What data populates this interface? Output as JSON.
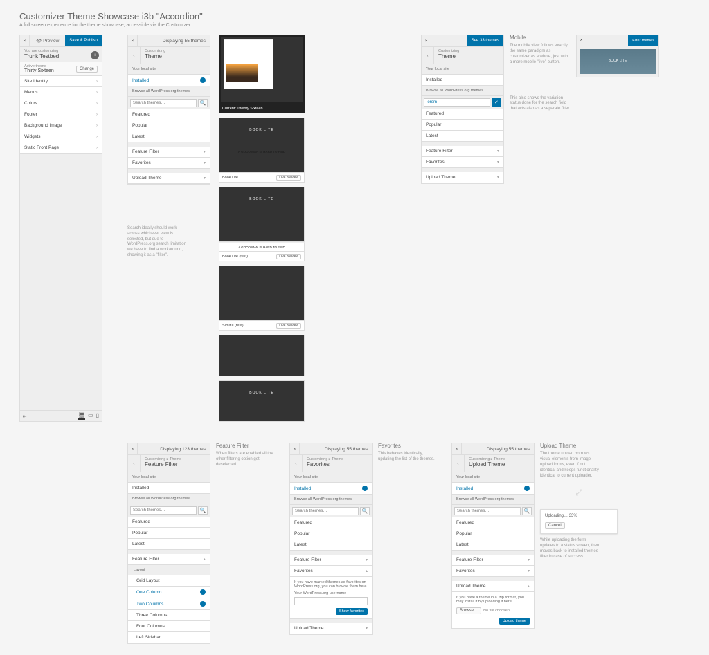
{
  "header": {
    "title": "Customizer Theme Showcase i3b \"Accordion\"",
    "subtitle": "A full screen experience for the theme showcase, accessible via the Customizer."
  },
  "p1": {
    "close_icon": "×",
    "preview_icon": "👁",
    "preview": "Preview",
    "save": "Save & Publish",
    "eyebrow": "You are customizing",
    "site": "Trunk Testbed",
    "info": "i",
    "active_label": "Active theme",
    "active_theme": "Thirty Sixteen",
    "change": "Change",
    "sections": [
      "Site Identity",
      "Menus",
      "Colors",
      "Footer",
      "Background Image",
      "Widgets",
      "Static Front Page"
    ],
    "collapse_icon": "⇤",
    "dev_desktop": "🖥",
    "dev_tablet": "▭",
    "dev_mobile": "▯"
  },
  "note_search": "Search ideally should work across whichever view is selected, but due to WordPress.org search limitation we have to find a workaround, showing it as a \"filter\".",
  "p2": {
    "count": "Displaying 55 themes",
    "back": "‹",
    "crumb": "Customizing",
    "title": "Theme",
    "local": "Your local site",
    "installed": "Installed",
    "browse": "Browse all WordPress.org themes",
    "search_ph": "Search themes…",
    "search_icon": "🔍",
    "cats": [
      "Featured",
      "Popular",
      "Latest"
    ],
    "filters": [
      "Feature Filter",
      "Favorites",
      "Upload Theme"
    ],
    "chev": "▾"
  },
  "themes": {
    "current_label": "Current: Twenty Sixteen",
    "live": "Live preview",
    "t_book": "BOOK LITE",
    "t_hard": "A GOOD MAN IS HARD TO FIND",
    "n_book": "Book Lite",
    "n_book_test": "Book Lite (test)",
    "n_sim": "Simiful (test)"
  },
  "p3": {
    "see": "See 33 themes",
    "crumb": "Customizing",
    "title": "Theme",
    "local": "Your local site",
    "installed": "Installed",
    "browse": "Browse all WordPress.org themes",
    "search_val": "lorem",
    "cats": [
      "Featured",
      "Popular",
      "Latest"
    ],
    "filters": [
      "Feature Filter",
      "Favorites",
      "Upload Theme"
    ]
  },
  "mobile": {
    "h": "Mobile",
    "p1": "The mobile view follows exactly the same paradigm as customizer as a whole, just with a more mobile \"live\" button.",
    "p2": "This also shows the variation status done for the search field that acts also as a separate filter.",
    "filter": "Filter themes"
  },
  "p4": {
    "count": "Displaying 123 themes",
    "crumb": "Customizing ▸ Theme",
    "title": "Feature Filter",
    "local": "Your local site",
    "installed": "Installed",
    "browse": "Browse all WordPress.org themes",
    "search_ph": "Search themes…",
    "cats": [
      "Featured",
      "Popular",
      "Latest"
    ],
    "ff": "Feature Filter",
    "layout": "Layout",
    "opts": [
      "Grid Layout",
      "One Column",
      "Two Columns",
      "Three Columns",
      "Four Columns",
      "Left Sidebar"
    ],
    "active": [
      1,
      2
    ]
  },
  "ff_note": {
    "h": "Feature Filter",
    "p": "When filters are enabled all the other filtering option get deselected."
  },
  "p5": {
    "count": "Displaying 55 themes",
    "crumb": "Customizing ▸ Theme",
    "title": "Favorites",
    "local": "Your local site",
    "installed": "Installed",
    "browse": "Browse all WordPress.org themes",
    "search_ph": "Search themes…",
    "cats": [
      "Featured",
      "Popular",
      "Latest"
    ],
    "ff": "Feature Filter",
    "fav": "Favorites",
    "favtxt": "If you have marked themes as favorites on WordPress.org, you can browse them here.",
    "userlbl": "Your WordPress.org username",
    "showfav": "Show favorites",
    "upload": "Upload Theme"
  },
  "fav_note": {
    "h": "Favorites",
    "p": "This behaves identically, updating the list of the themes."
  },
  "p6": {
    "count": "Displaying 55 themes",
    "crumb": "Customizing ▸ Theme",
    "title": "Upload Theme",
    "local": "Your local site",
    "installed": "Installed",
    "browse": "Browse all WordPress.org themes",
    "search_ph": "Search themes…",
    "cats": [
      "Featured",
      "Popular",
      "Latest"
    ],
    "ff": "Feature Filter",
    "fav": "Favorites",
    "upload": "Upload Theme",
    "uptxt": "If you have a theme in a .zip format, you may install it by uploading it here.",
    "browse_btn": "Browse…",
    "nofile": "No file choosen.",
    "upload_btn": "Upload theme"
  },
  "up_note": {
    "h": "Upload Theme",
    "p": "The theme upload borrows visual elements from image upload forms, even if not identical and keeps functionality identical to current uploader.",
    "p2": "While uploading the form updates to a status screen, then moves back to installed themes filter in case of success.",
    "uploading": "Uploading… 33%",
    "cancel": "Cancel"
  }
}
